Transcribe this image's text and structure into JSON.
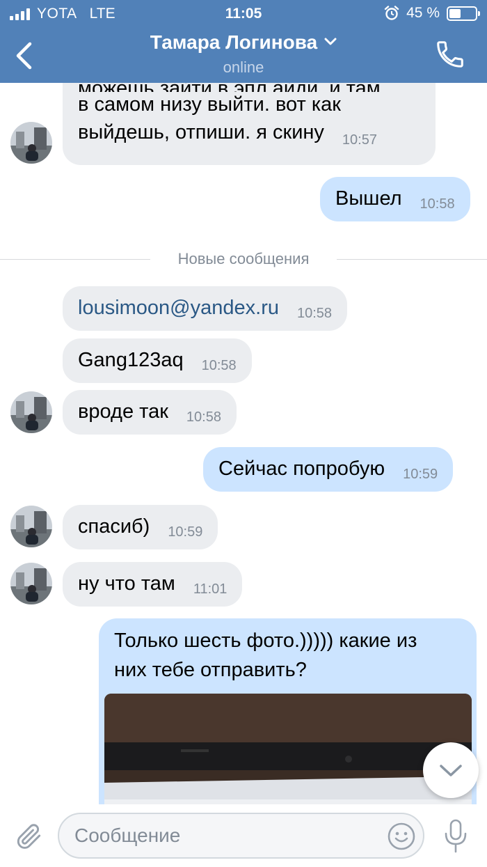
{
  "status_bar": {
    "carrier": "YOTA",
    "network": "LTE",
    "time": "11:05",
    "battery": "45 %",
    "battery_level": 0.45
  },
  "header": {
    "title": "Тамара Логинова",
    "status": "online",
    "icons": {
      "back": "chevron-left-icon",
      "title_toggle": "chevron-down-icon",
      "call": "phone-icon"
    }
  },
  "messages": {
    "m1": {
      "line2": "в самом низу выйти. вот как",
      "line3": "выйдешь, отпиши. я скину",
      "time": "10:57"
    },
    "m2": {
      "text": "Вышел",
      "time": "10:58"
    },
    "divider": "Новые сообщения",
    "m3": {
      "text": "lousimoon@yandex.ru",
      "time": "10:58"
    },
    "m4": {
      "text": "Gang123aq",
      "time": "10:58"
    },
    "m5": {
      "text": "вроде так",
      "time": "10:58"
    },
    "m6": {
      "text": "Сейчас попробую",
      "time": "10:59"
    },
    "m7": {
      "text": "спасиб)",
      "time": "10:59"
    },
    "m8": {
      "text": "ну что там",
      "time": "11:01"
    },
    "m9": {
      "line1": "Только шесть фото.))))) какие из",
      "line2": "них тебе отправить?"
    }
  },
  "composer": {
    "placeholder": "Сообщение",
    "icons": {
      "attach": "paperclip-icon",
      "emoji": "smiley-icon",
      "mic": "microphone-icon",
      "scroll": "chevron-down-icon"
    }
  },
  "colors": {
    "header": "#5181b8",
    "incoming_bubble": "#ebedf0",
    "outgoing_bubble": "#cce4ff",
    "link": "#2a5885",
    "timestamp": "#828b96"
  }
}
